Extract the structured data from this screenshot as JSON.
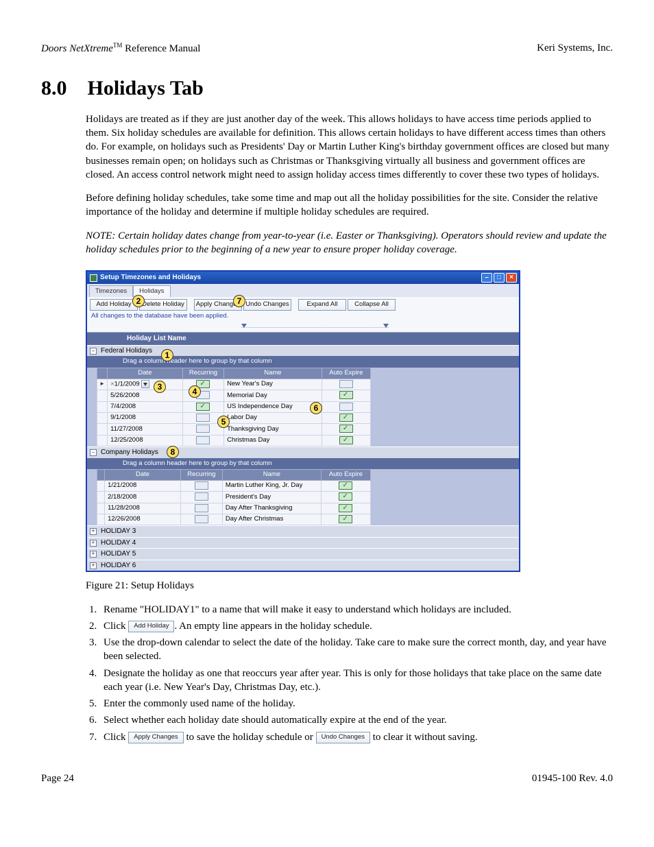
{
  "header": {
    "brand": "Doors NetXtreme",
    "tm": "TM",
    "ref": " Reference Manual",
    "right": "Keri Systems, Inc."
  },
  "section": {
    "num": "8.0",
    "title": "Holidays Tab"
  },
  "para1": "Holidays are treated as if they are just another day of the week. This allows holidays to have access time periods applied to them. Six holiday schedules are available for definition. This allows certain holidays to have different access times than others do. For example, on holidays such as Presidents' Day or Martin Luther King's birthday government offices are closed but many businesses remain open; on holidays such as Christmas or Thanksgiving virtually all business and government offices are closed. An access control network might need to assign holiday access times differently to cover these two types of holidays.",
  "para2": "Before defining holiday schedules, take some time and map out all the holiday possibilities for the site. Consider the relative importance of the holiday and determine if multiple holiday schedules are required.",
  "note": "NOTE: Certain holiday dates change from year-to-year (i.e. Easter or Thanksgiving). Operators should review and update the holiday schedules prior to the beginning of a new year to ensure proper holiday coverage.",
  "window": {
    "title": "Setup Timezones and Holidays",
    "tabs": [
      "Timezones",
      "Holidays"
    ],
    "active_tab": 1,
    "buttons": {
      "add": "Add Holiday",
      "del": "Delete Holiday",
      "apply": "Apply Changes",
      "undo": "Undo Changes",
      "expand": "Expand All",
      "collapse": "Collapse All"
    },
    "status": "All changes to the database have been applied.",
    "list_header": "Holiday List Name",
    "group_msg": "Drag a column header here to group by that column",
    "cols": {
      "date": "Date",
      "recur": "Recurring",
      "name": "Name",
      "exp": "Auto Expire"
    },
    "lists": [
      {
        "name": "Federal Holidays",
        "expanded": true,
        "rows": [
          {
            "date": "1/1/2009",
            "recur": true,
            "name": "New Year's Day",
            "exp": false,
            "edit": true
          },
          {
            "date": "5/26/2008",
            "recur": false,
            "name": "Memorial Day",
            "exp": true
          },
          {
            "date": "7/4/2008",
            "recur": true,
            "name": "US Independence Day",
            "exp": false
          },
          {
            "date": "9/1/2008",
            "recur": false,
            "name": "Labor Day",
            "exp": true
          },
          {
            "date": "11/27/2008",
            "recur": false,
            "name": "Thanksgiving Day",
            "exp": true
          },
          {
            "date": "12/25/2008",
            "recur": false,
            "name": "Christmas Day",
            "exp": true
          }
        ]
      },
      {
        "name": "Company Holidays",
        "expanded": true,
        "rows": [
          {
            "date": "1/21/2008",
            "recur": false,
            "name": "Martin Luther King, Jr. Day",
            "exp": true
          },
          {
            "date": "2/18/2008",
            "recur": false,
            "name": "President's Day",
            "exp": true
          },
          {
            "date": "11/28/2008",
            "recur": false,
            "name": "Day After Thanksgiving",
            "exp": true
          },
          {
            "date": "12/26/2008",
            "recur": false,
            "name": "Day After Christmas",
            "exp": true
          }
        ]
      },
      {
        "name": "HOLIDAY 3",
        "expanded": false
      },
      {
        "name": "HOLIDAY 4",
        "expanded": false
      },
      {
        "name": "HOLIDAY 5",
        "expanded": false
      },
      {
        "name": "HOLIDAY 6",
        "expanded": false
      }
    ],
    "callouts": {
      "c1": "1",
      "c2": "2",
      "c3": "3",
      "c4": "4",
      "c5": "5",
      "c6": "6",
      "c7": "7",
      "c8": "8"
    }
  },
  "fig_caption": "Figure 21: Setup Holidays",
  "steps": {
    "s1": "Rename \"HOLIDAY1\" to a name that will make it easy to understand which holidays are included.",
    "s2a": "Click ",
    "s2btn": "Add Holiday",
    "s2b": ". An empty line appears in the holiday schedule.",
    "s3": "Use the drop-down calendar to select the date of the holiday. Take care to make sure the correct month, day, and year have been selected.",
    "s4": "Designate the holiday as one that reoccurs year after year. This is only for those holidays that take place on the same date each year (i.e. New Year's Day, Christmas Day, etc.).",
    "s5": "Enter the commonly used name of the holiday.",
    "s6": "Select whether each holiday date should automatically expire at the end of the year.",
    "s7a": "Click ",
    "s7btn1": "Apply Changes",
    "s7b": " to save the holiday schedule or ",
    "s7btn2": "Undo Changes",
    "s7c": " to clear it without saving."
  },
  "footer": {
    "left": "Page 24",
    "right": "01945-100  Rev. 4.0"
  }
}
